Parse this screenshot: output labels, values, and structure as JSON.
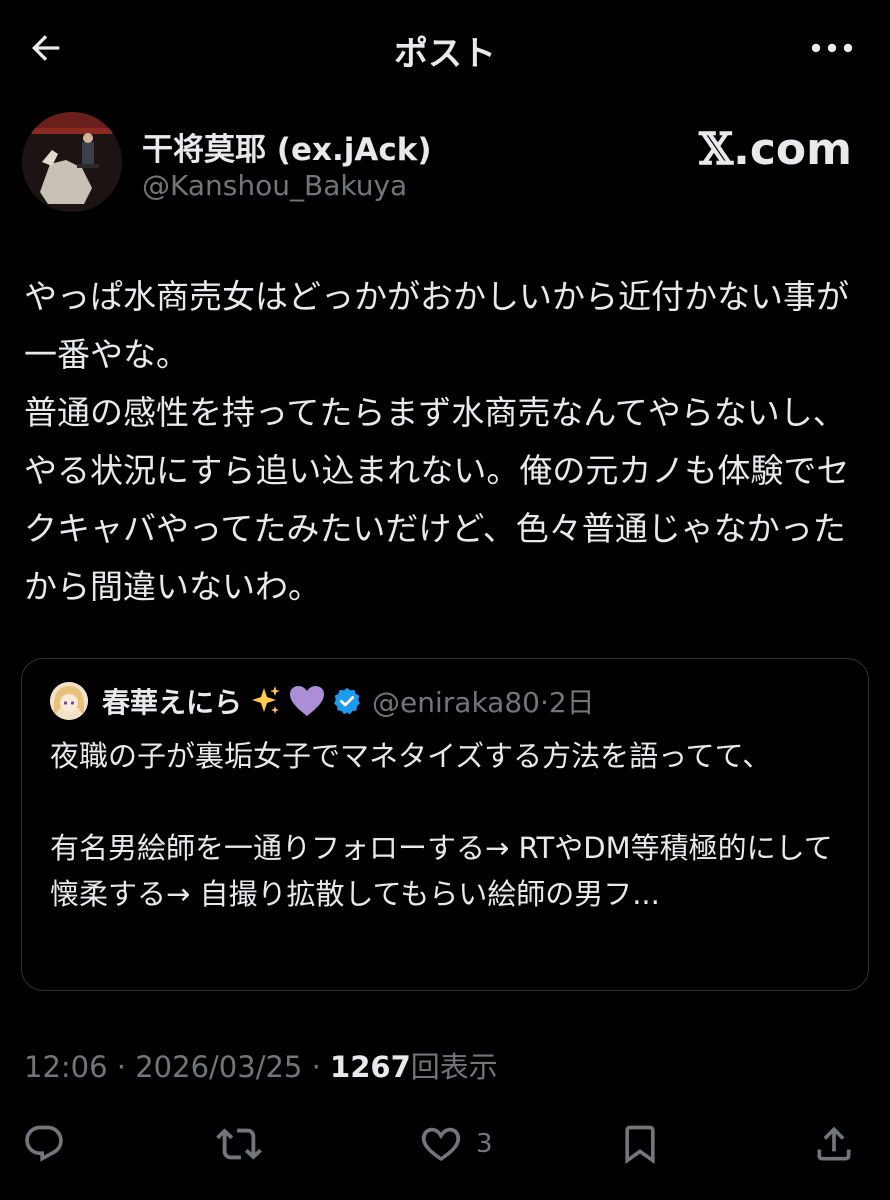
{
  "header": {
    "title": "ポスト"
  },
  "author": {
    "display_name": "干将莫耶 (ex.jAck)",
    "handle": "@Kanshou_Bakuya"
  },
  "watermark": {
    "x_symbol": "𝕏",
    "suffix": ".com"
  },
  "post": {
    "text": "やっぱ水商売女はどっかがおかしいから近付かない事が一番やな。\n普通の感性を持ってたらまず水商売なんてやらないし、やる状況にすら追い込まれない。俺の元カノも体験でセクキャバやってたみたいだけど、色々普通じゃなかったから間違いないわ。"
  },
  "quote": {
    "name": "春華えにら",
    "emoji": [
      "sparkles-icon",
      "purple-heart-icon"
    ],
    "verified": true,
    "handle": "@eniraka80",
    "separator": "·",
    "time": "2日",
    "text": "夜職の子が裏垢女子でマネタイズする方法を語ってて、\n\n有名男絵師を一通りフォローする→ RTやDM等積極的にして懐柔する→ 自撮り拡散してもらい絵師の男フ..."
  },
  "meta": {
    "time": "12:06",
    "dot1": "·",
    "date": "2026/03/25",
    "dot2": "·",
    "views": "1267",
    "views_label": "回表示"
  },
  "actions": {
    "reply": {
      "icon": "reply-icon",
      "count": ""
    },
    "retweet": {
      "icon": "retweet-icon",
      "count": ""
    },
    "like": {
      "icon": "heart-icon",
      "count": "3"
    },
    "bookmark": {
      "icon": "bookmark-icon",
      "count": ""
    },
    "share": {
      "icon": "share-icon",
      "count": ""
    }
  },
  "colors": {
    "background": "#000000",
    "text": "#e7e9ea",
    "muted": "#71767b",
    "border": "#2f3336",
    "verified": "#1d9bf0"
  }
}
